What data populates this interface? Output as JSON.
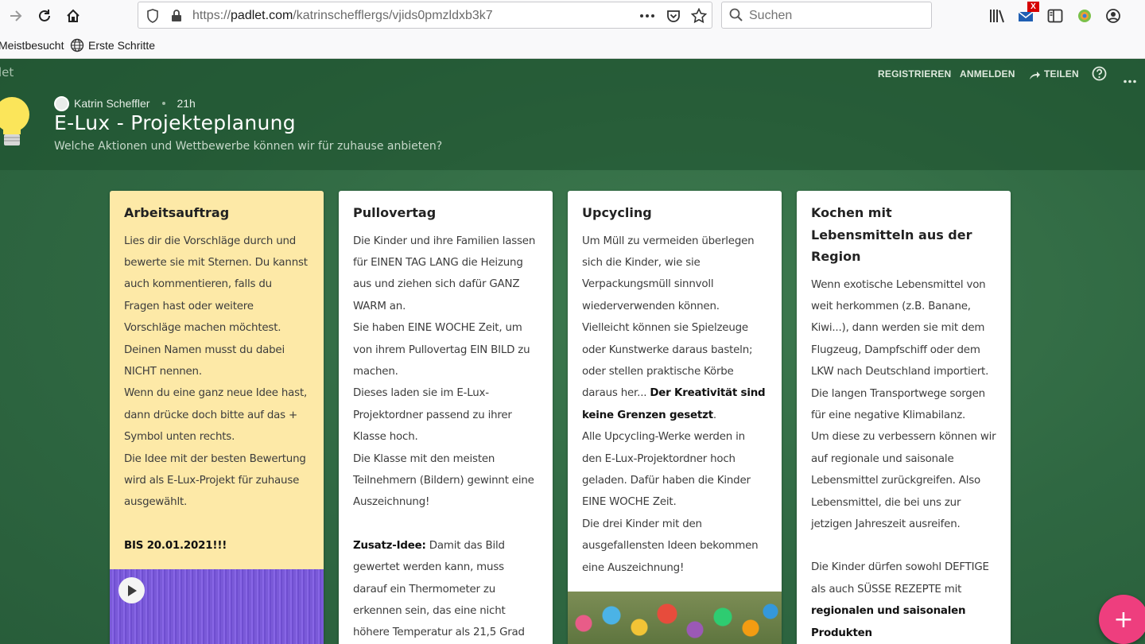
{
  "browser": {
    "url_prefix": "https://",
    "url_host": "padlet.com",
    "url_path": "/katrinschefflergs/vjids0pmzldxb3k7",
    "search_placeholder": "Suchen",
    "mail_badge": "X",
    "bookmarks": [
      {
        "label": "Meistbesucht"
      },
      {
        "label": "Erste Schritte"
      }
    ]
  },
  "padlet": {
    "brand": "let",
    "nav": {
      "register": "REGISTRIEREN",
      "login": "ANMELDEN",
      "share": "TEILEN"
    },
    "author": "Katrin Scheffler",
    "time": "21h",
    "title": "E-Lux - Projekteplanung",
    "subtitle": "Welche Aktionen und Wettbewerbe können wir für zuhause anbieten?",
    "fab_label": "+",
    "colors": {
      "background": "#2f6842",
      "yellow_card": "#fde9a7",
      "fab": "#ee3e7e",
      "audio": "#7a5ad8"
    }
  },
  "cards": [
    {
      "title": "Arbeitsauftrag",
      "p1": "Lies dir die Vorschläge durch und bewerte sie mit Sternen. Du kannst auch kommentieren, falls du Fragen hast oder weitere Vorschläge machen möchtest.",
      "p2": "Deinen Namen musst du dabei NICHT nennen.",
      "p3": "Wenn du eine ganz neue Idee hast, dann drücke doch bitte auf das + Symbol unten rechts.",
      "p4": "Die Idee mit der besten Bewertung wird als E-Lux-Projekt für zuhause ausgewählt.",
      "deadline": "BIS 20.01.2021!!!"
    },
    {
      "title": "Pullovertag",
      "p1": "Die Kinder und ihre Familien lassen für EINEN TAG LANG die Heizung aus und ziehen sich dafür GANZ WARM an.",
      "p2": "Sie haben EINE WOCHE Zeit, um von ihrem Pullovertag EIN BILD zu machen.",
      "p3": "Dieses laden sie im E-Lux-Projektordner passend zu ihrer Klasse hoch.",
      "p4": "Die Klasse mit den meisten Teilnehmern (Bildern) gewinnt eine Auszeichnung!",
      "extra_bold": "Zusatz-Idee:",
      "extra_text": " Damit das Bild gewertet werden kann, muss darauf ein Thermometer zu erkennen sein, das eine nicht höhere Temperatur als 21,5 Grad"
    },
    {
      "title": "Upcycling",
      "p1": "Um Müll zu vermeiden überlegen sich die Kinder, wie sie Verpackungsmüll sinnvoll wiederverwenden können.",
      "p2": "Vielleicht können sie Spielzeuge oder Kunstwerke daraus basteln; oder stellen praktische Körbe daraus her... ",
      "p2_bold": "Der Kreativität sind keine Grenzen gesetzt",
      "p2_end": ".",
      "p3": "Alle Upcycling-Werke werden in den E-Lux-Projektordner hoch geladen. Dafür haben die Kinder EINE WOCHE Zeit.",
      "p4": "Die drei Kinder mit den ausgefallensten Ideen bekommen eine Auszeichnung!"
    },
    {
      "title": "Kochen mit Lebensmitteln aus der Region",
      "p1": "Wenn exotische Lebensmittel von weit herkommen (z.B. Banane, Kiwi...), dann werden sie mit dem Flugzeug, Dampfschiff oder dem LKW nach Deutschland importiert. Die langen Transportwege sorgen für eine negative Klimabilanz.",
      "p2": "Um diese zu verbessern können wir auf regionale und saisonale Lebensmittel zurückgreifen. Also Lebensmittel, die bei uns zur jetzigen Jahreszeit ausreifen.",
      "p3": "Die Kinder dürfen sowohl DEFTIGE als auch SÜSSE REZEPTE mit ",
      "p3_bold": "regionalen und saisonalen Produkten"
    }
  ]
}
